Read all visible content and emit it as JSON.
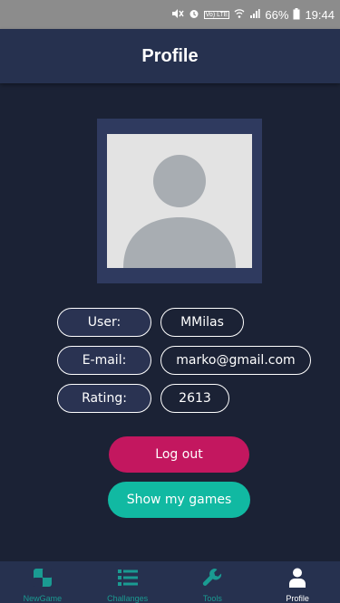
{
  "status_bar": {
    "lte_label": "Vo)\nLTE",
    "battery": "66%",
    "time": "19:44"
  },
  "header": {
    "title": "Profile"
  },
  "profile": {
    "fields": [
      {
        "label": "User:",
        "value": "MMilas"
      },
      {
        "label": "E-mail:",
        "value": "marko@gmail.com"
      },
      {
        "label": "Rating:",
        "value": "2613"
      }
    ]
  },
  "actions": {
    "logout_label": "Log out",
    "show_games_label": "Show my games"
  },
  "bottom_nav": {
    "items": [
      {
        "label": "NewGame",
        "icon": "board-icon"
      },
      {
        "label": "Challanges",
        "icon": "list-icon"
      },
      {
        "label": "Tools",
        "icon": "wrench-icon"
      },
      {
        "label": "Profile",
        "icon": "person-icon"
      }
    ],
    "active": "Profile"
  },
  "colors": {
    "background": "#1b2235",
    "header": "#26314f",
    "logout": "#c3175f",
    "show_games": "#11b9a2",
    "nav_inactive": "#1a9b92",
    "nav_active": "#ffffff"
  }
}
